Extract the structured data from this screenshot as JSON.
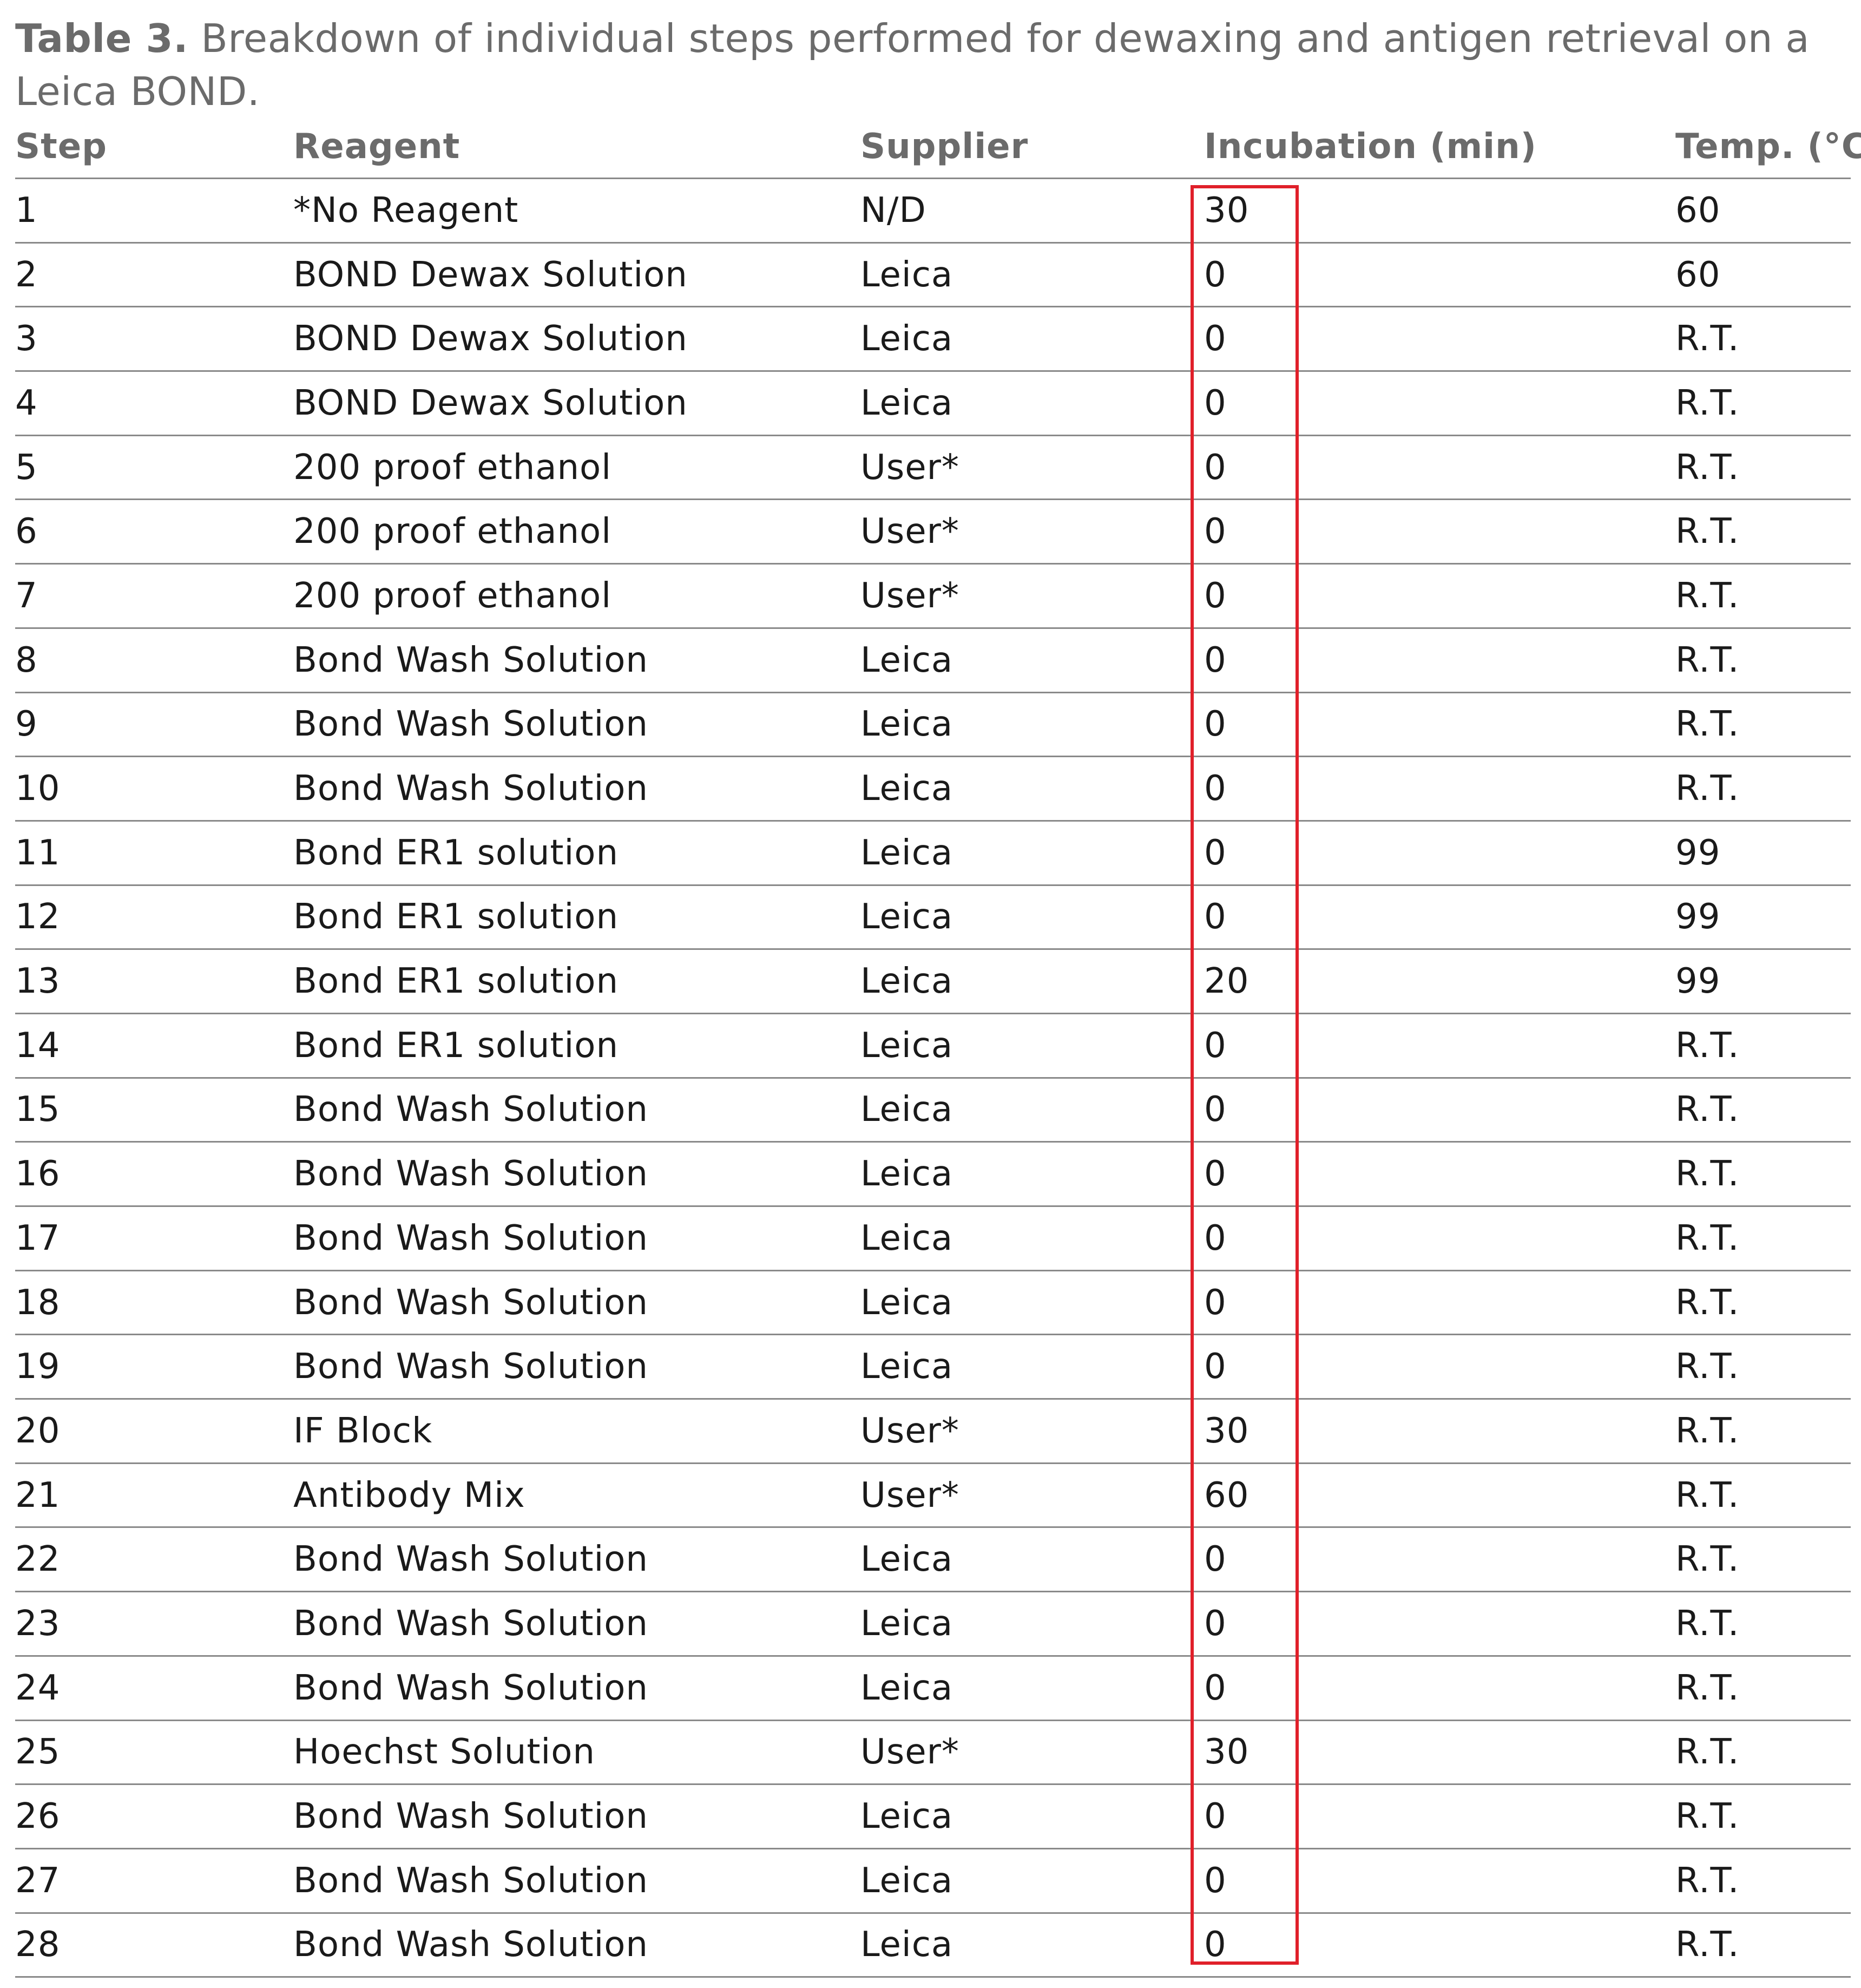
{
  "caption": {
    "label": "Table 3.",
    "text": " Breakdown of individual steps performed for dewaxing and antigen retrieval on a Leica BOND."
  },
  "table": {
    "headers": {
      "step": "Step",
      "reagent": "Reagent",
      "supplier": "Supplier",
      "incubation": "Incubation (min)",
      "temp": "Temp. (°C)"
    },
    "rows": [
      {
        "step": "1",
        "reagent": "*No Reagent",
        "supplier": "N/D",
        "incubation": "30",
        "temp": "60"
      },
      {
        "step": "2",
        "reagent": "BOND Dewax Solution",
        "supplier": "Leica",
        "incubation": "0",
        "temp": "60"
      },
      {
        "step": "3",
        "reagent": "BOND Dewax Solution",
        "supplier": "Leica",
        "incubation": "0",
        "temp": "R.T."
      },
      {
        "step": "4",
        "reagent": "BOND Dewax Solution",
        "supplier": "Leica",
        "incubation": "0",
        "temp": "R.T."
      },
      {
        "step": "5",
        "reagent": "200 proof ethanol",
        "supplier": "User*",
        "incubation": "0",
        "temp": "R.T."
      },
      {
        "step": "6",
        "reagent": "200 proof ethanol",
        "supplier": "User*",
        "incubation": "0",
        "temp": "R.T."
      },
      {
        "step": "7",
        "reagent": "200 proof ethanol",
        "supplier": "User*",
        "incubation": "0",
        "temp": "R.T."
      },
      {
        "step": "8",
        "reagent": "Bond Wash Solution",
        "supplier": "Leica",
        "incubation": "0",
        "temp": "R.T."
      },
      {
        "step": "9",
        "reagent": "Bond Wash Solution",
        "supplier": "Leica",
        "incubation": "0",
        "temp": "R.T."
      },
      {
        "step": "10",
        "reagent": "Bond Wash Solution",
        "supplier": "Leica",
        "incubation": "0",
        "temp": "R.T."
      },
      {
        "step": "11",
        "reagent": "Bond ER1 solution",
        "supplier": "Leica",
        "incubation": "0",
        "temp": "99"
      },
      {
        "step": "12",
        "reagent": "Bond ER1 solution",
        "supplier": "Leica",
        "incubation": "0",
        "temp": "99"
      },
      {
        "step": "13",
        "reagent": "Bond ER1 solution",
        "supplier": "Leica",
        "incubation": "20",
        "temp": "99"
      },
      {
        "step": "14",
        "reagent": "Bond ER1 solution",
        "supplier": "Leica",
        "incubation": "0",
        "temp": "R.T."
      },
      {
        "step": "15",
        "reagent": "Bond Wash Solution",
        "supplier": "Leica",
        "incubation": "0",
        "temp": "R.T."
      },
      {
        "step": "16",
        "reagent": "Bond Wash Solution",
        "supplier": "Leica",
        "incubation": "0",
        "temp": "R.T."
      },
      {
        "step": "17",
        "reagent": "Bond Wash Solution",
        "supplier": "Leica",
        "incubation": "0",
        "temp": "R.T."
      },
      {
        "step": "18",
        "reagent": "Bond Wash Solution",
        "supplier": "Leica",
        "incubation": "0",
        "temp": "R.T."
      },
      {
        "step": "19",
        "reagent": "Bond Wash Solution",
        "supplier": "Leica",
        "incubation": "0",
        "temp": "R.T."
      },
      {
        "step": "20",
        "reagent": "IF Block",
        "supplier": "User*",
        "incubation": "30",
        "temp": "R.T."
      },
      {
        "step": "21",
        "reagent": "Antibody Mix",
        "supplier": "User*",
        "incubation": "60",
        "temp": "R.T."
      },
      {
        "step": "22",
        "reagent": "Bond Wash Solution",
        "supplier": "Leica",
        "incubation": "0",
        "temp": "R.T."
      },
      {
        "step": "23",
        "reagent": "Bond Wash Solution",
        "supplier": "Leica",
        "incubation": "0",
        "temp": "R.T."
      },
      {
        "step": "24",
        "reagent": "Bond Wash Solution",
        "supplier": "Leica",
        "incubation": "0",
        "temp": "R.T."
      },
      {
        "step": "25",
        "reagent": "Hoechst Solution",
        "supplier": "User*",
        "incubation": "30",
        "temp": "R.T."
      },
      {
        "step": "26",
        "reagent": "Bond Wash Solution",
        "supplier": "Leica",
        "incubation": "0",
        "temp": "R.T."
      },
      {
        "step": "27",
        "reagent": "Bond Wash Solution",
        "supplier": "Leica",
        "incubation": "0",
        "temp": "R.T."
      },
      {
        "step": "28",
        "reagent": "Bond Wash Solution",
        "supplier": "Leica",
        "incubation": "0",
        "temp": "R.T."
      }
    ]
  },
  "highlight": {
    "color": "#e0202a",
    "column": "incubation"
  }
}
